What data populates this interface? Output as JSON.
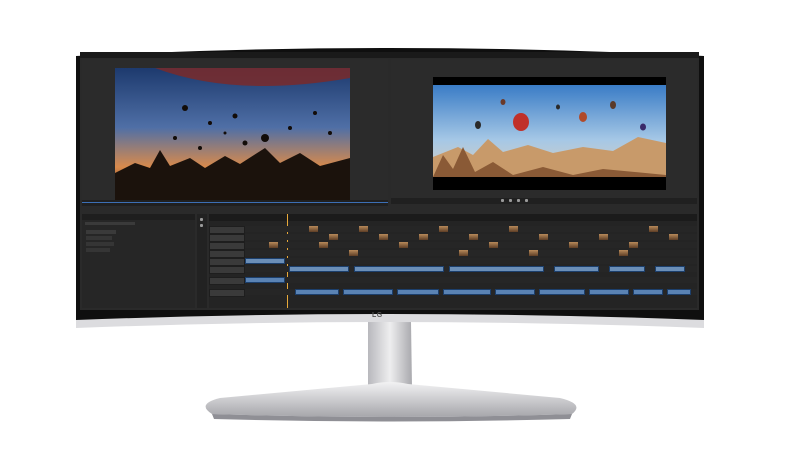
{
  "device": {
    "brand_logo": "LG"
  },
  "colors": {
    "bezel": "#0f0f0f",
    "ui_background": "#2a2a2a",
    "video_clip": "#6b8fb8",
    "audio_clip": "#5a83b4",
    "playhead": "#e8a93a",
    "stand": "#c8c8cc"
  },
  "editor": {
    "source_monitor": {
      "image": "hot-air-balloons-silhouette-dusk"
    },
    "program_monitor": {
      "image": "hot-air-balloons-over-rock-formations"
    },
    "timeline": {
      "video_tracks": 6,
      "audio_tracks": 2
    },
    "project_panel": {
      "items": [
        "",
        "",
        "",
        ""
      ]
    }
  }
}
